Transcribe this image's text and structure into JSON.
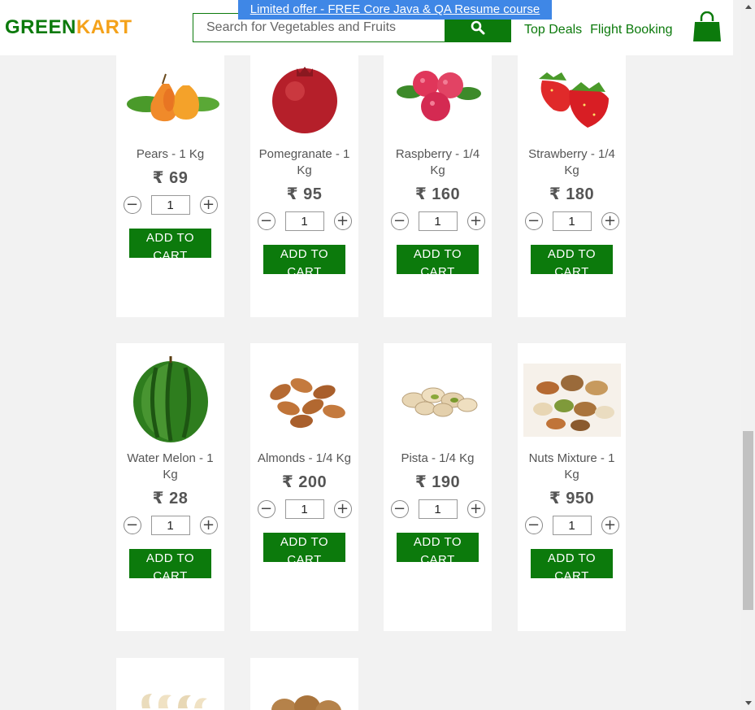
{
  "header": {
    "logo_green": "GREEN",
    "logo_kart": "KART",
    "promo": "Limited offer - FREE Core Java & QA Resume course",
    "search_placeholder": "Search for Vegetables and Fruits",
    "nav": [
      "Top Deals",
      "Flight Booking"
    ]
  },
  "icons": {
    "search": "search-icon",
    "cart": "shopping-bag-icon"
  },
  "colors": {
    "brand_green": "#0c7a0c",
    "brand_orange": "#f4a21b",
    "promo_blue": "#3f87e6"
  },
  "products": [
    {
      "name": "Pears - 1 Kg",
      "price": "₹ 69",
      "qty": "1",
      "button": "ADD TO CART",
      "image": "pears"
    },
    {
      "name": "Pomegranate - 1 Kg",
      "price": "₹ 95",
      "qty": "1",
      "button": "ADD TO CART",
      "image": "pomegranate"
    },
    {
      "name": "Raspberry - 1/4 Kg",
      "price": "₹ 160",
      "qty": "1",
      "button": "ADD TO CART",
      "image": "raspberry"
    },
    {
      "name": "Strawberry - 1/4 Kg",
      "price": "₹ 180",
      "qty": "1",
      "button": "ADD TO CART",
      "image": "strawberry"
    },
    {
      "name": "Water Melon - 1 Kg",
      "price": "₹ 28",
      "qty": "1",
      "button": "ADD TO CART",
      "image": "watermelon"
    },
    {
      "name": "Almonds - 1/4 Kg",
      "price": "₹ 200",
      "qty": "1",
      "button": "ADD TO CART",
      "image": "almonds"
    },
    {
      "name": "Pista - 1/4 Kg",
      "price": "₹ 190",
      "qty": "1",
      "button": "ADD TO CART",
      "image": "pista"
    },
    {
      "name": "Nuts Mixture - 1 Kg",
      "price": "₹ 950",
      "qty": "1",
      "button": "ADD TO CART",
      "image": "nuts-mixture"
    },
    {
      "image": "cashews"
    },
    {
      "image": "walnuts"
    }
  ]
}
